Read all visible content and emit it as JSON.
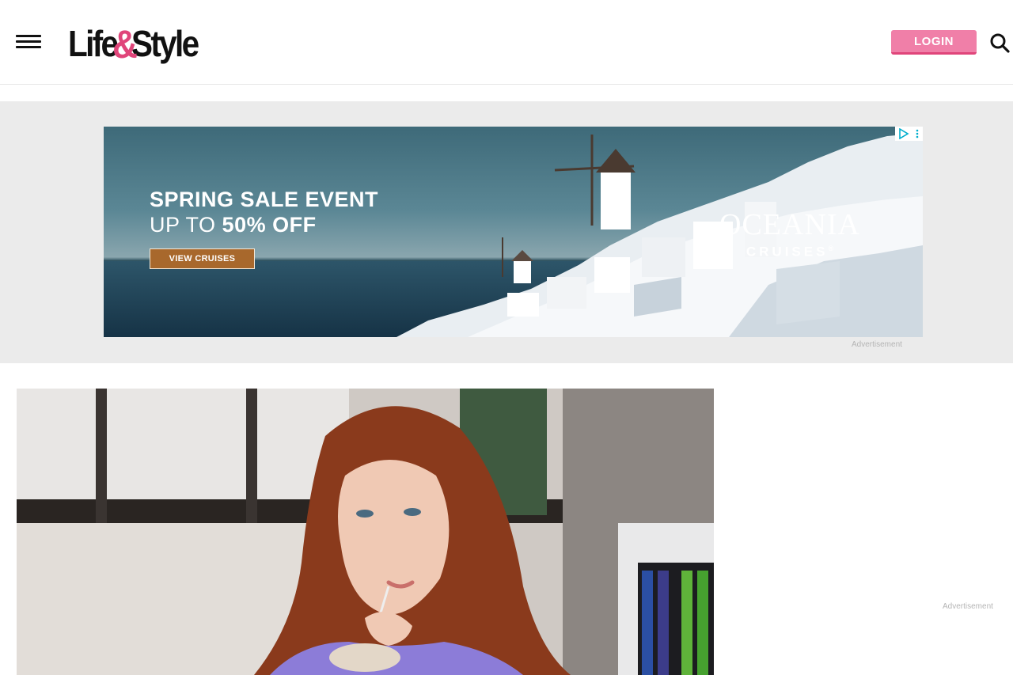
{
  "header": {
    "logo_text_part1": "Life",
    "logo_text_amp": "&",
    "logo_text_part2": "Style",
    "login_label": "LOGIN",
    "brand_color": "#e0457a",
    "login_color": "#f07fa8",
    "menu_icon": "hamburger-icon",
    "search_icon": "search-icon"
  },
  "ad_banner": {
    "headline_line1": "SPRING SALE EVENT",
    "headline_line2_prefix": "UP TO ",
    "headline_line2_bold": "50% OFF",
    "cta_label": "VIEW CRUISES",
    "brand_name": "OCEANIA",
    "brand_sub": "CRUISES",
    "brand_sub_mark": "®",
    "cta_color": "#a8682c",
    "ad_choices_icon": "adchoices-icon",
    "label": "Advertisement"
  },
  "sidebar": {
    "ad_label": "Advertisement"
  },
  "article": {
    "hero_image": "woman-with-red-hair-drinking-through-straw"
  }
}
